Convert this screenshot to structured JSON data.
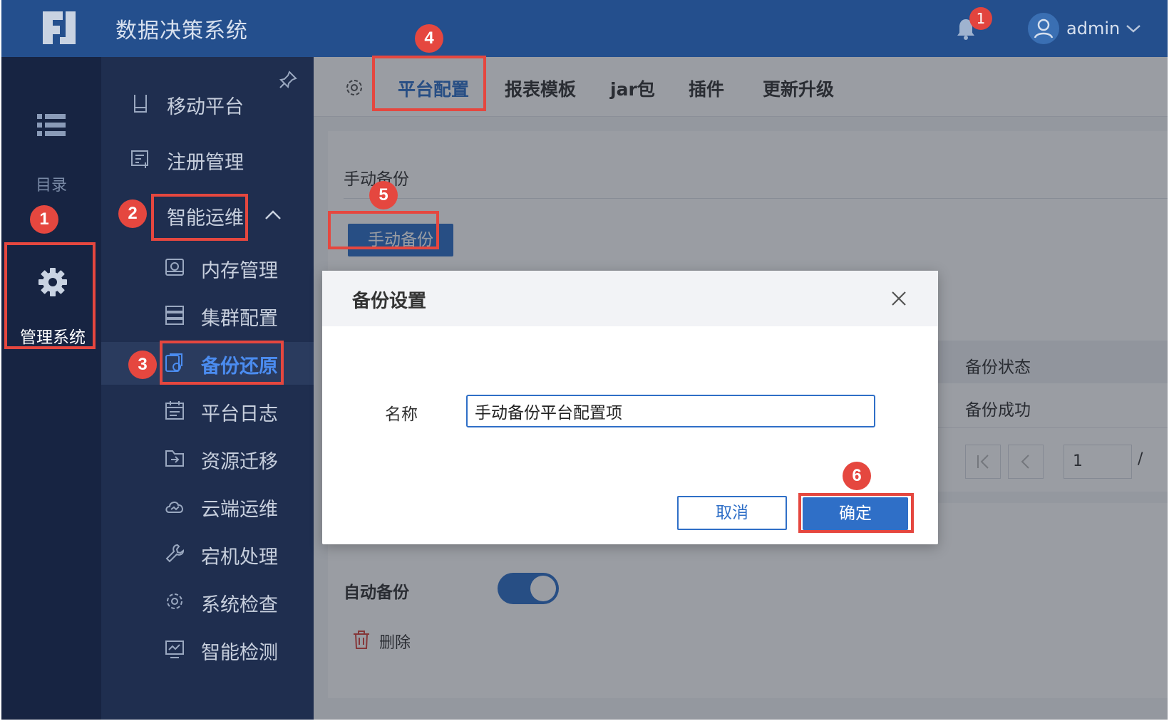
{
  "app": {
    "title": "数据决策系统",
    "notification_count": "1",
    "username": "admin",
    "accent_color": "#2f6fc7",
    "header_color": "#244f8d"
  },
  "rail": {
    "catalog_label": "目录",
    "admin_label": "管理系统"
  },
  "menu": {
    "mobile_platform": "移动平台",
    "register_mgmt": "注册管理",
    "smart_ops": "智能运维",
    "sub_items": [
      {
        "label": "内存管理",
        "icon": "memory-icon"
      },
      {
        "label": "集群配置",
        "icon": "cluster-icon"
      },
      {
        "label": "备份还原",
        "icon": "backup-icon"
      },
      {
        "label": "平台日志",
        "icon": "log-icon"
      },
      {
        "label": "资源迁移",
        "icon": "migrate-icon"
      },
      {
        "label": "云端运维",
        "icon": "cloud-icon"
      },
      {
        "label": "宕机处理",
        "icon": "wrench-icon"
      },
      {
        "label": "系统检查",
        "icon": "gear-icon"
      },
      {
        "label": "智能检测",
        "icon": "monitor-icon"
      }
    ],
    "active_item": "备份还原"
  },
  "tabs": {
    "items": [
      "平台配置",
      "报表模板",
      "jar包",
      "插件",
      "更新升级"
    ],
    "active": "平台配置"
  },
  "backup": {
    "section_title": "手动备份",
    "manual_button": "手动备份",
    "table": {
      "status_header": "备份状态",
      "status_value": "备份成功"
    },
    "pagination": {
      "page_value": "1",
      "separator": "/"
    },
    "auto_label": "自动备份",
    "auto_enabled": true,
    "delete_label": "删除"
  },
  "dialog": {
    "title": "备份设置",
    "name_label": "名称",
    "name_value": "手动备份平台配置项",
    "cancel_label": "取消",
    "ok_label": "确定"
  },
  "annotations": {
    "steps": [
      "1",
      "2",
      "3",
      "4",
      "5",
      "6"
    ],
    "highlight_color": "#e5473f"
  }
}
